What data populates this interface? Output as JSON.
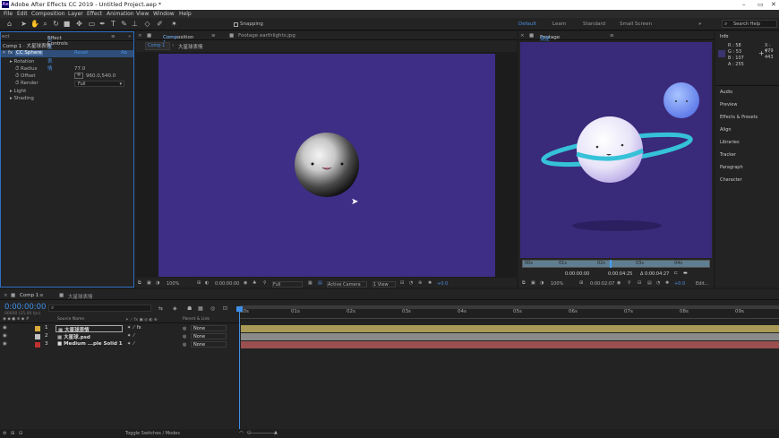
{
  "window": {
    "title": "Adobe After Effects CC 2019 - Untitled Project.aep *",
    "logo": "Ae",
    "controls": [
      "–",
      "▭",
      "✕"
    ]
  },
  "menu": [
    "File",
    "Edit",
    "Composition",
    "Layer",
    "Effect",
    "Animation",
    "View",
    "Window",
    "Help"
  ],
  "toolbar": {
    "snapping_label": "Snapping",
    "workspaces": [
      "Default",
      "Learn",
      "Standard",
      "Small Screen"
    ],
    "search_placeholder": "Search Help"
  },
  "effect_controls": {
    "tab_left": "ect",
    "tab_label": "Effect Controls",
    "tab_layer": "大星球表情",
    "breadcrumb": "Comp 1 · 大星球表情",
    "effect_name": "CC Sphere",
    "reset": "Reset",
    "about": "Ab",
    "rows": [
      {
        "label": "Rotation"
      },
      {
        "label": "Radius",
        "value": "77.0"
      },
      {
        "label": "Offset",
        "value": "960.0,540.0"
      },
      {
        "label": "Render",
        "value": "Full"
      },
      {
        "label": "Light"
      },
      {
        "label": "Shading"
      }
    ]
  },
  "composition": {
    "tab_label": "Composition",
    "tab_comp": "Comp 1",
    "footage_tab": "Footage earthlights.jpg",
    "subtab_comp": "Comp 1",
    "subtab_layer": "大星球表情",
    "footer": {
      "zoom": "100%",
      "time": "0:00:00:00",
      "resolution": "Full",
      "camera": "Active Camera",
      "view": "1 View",
      "exposure": "+0.0"
    }
  },
  "footage": {
    "tab_label": "Footage",
    "tab_name": "我是的小星球.gif",
    "ruler": [
      "00s",
      "01s",
      "02s",
      "03s",
      "04s",
      "05s"
    ],
    "times": {
      "in": "0:00:00:00",
      "out": "0:00:04:25",
      "duration": "Δ 0:00:04:27"
    },
    "footer": {
      "zoom": "100%",
      "time": "0:00:02:07",
      "exposure": "+0.0",
      "edit": "Edit..."
    }
  },
  "info": {
    "title": "Info",
    "r": "R : 58",
    "g": "G : 53",
    "b": "B : 107",
    "a": "A : 255",
    "x": "X : 479",
    "y": "Y : 443",
    "panels": [
      "Audio",
      "Preview",
      "Effects & Presets",
      "Align",
      "Libraries",
      "Tracker",
      "Paragraph",
      "Character"
    ]
  },
  "timeline": {
    "tab_comp": "Comp 1",
    "tab_layer": "大星球表情",
    "current_time": "0:00:00:00",
    "fps": "00000 (25.00 fps)",
    "col_source": "Source Name",
    "col_parent": "Parent & Link",
    "ruler": [
      "00s",
      "01s",
      "02s",
      "03s",
      "04s",
      "05s",
      "06s",
      "07s",
      "08s",
      "09s"
    ],
    "layers": [
      {
        "num": "1",
        "name": "大星球表情",
        "parent": "None",
        "color": "#d9a93c"
      },
      {
        "num": "2",
        "name": "大星球.psd",
        "parent": "None",
        "color": "#c0c0c0"
      },
      {
        "num": "3",
        "name": "Medium ...ple Solid 1",
        "parent": "None",
        "color": "#c03030"
      }
    ],
    "toggle": "Toggle Switches / Modes"
  }
}
